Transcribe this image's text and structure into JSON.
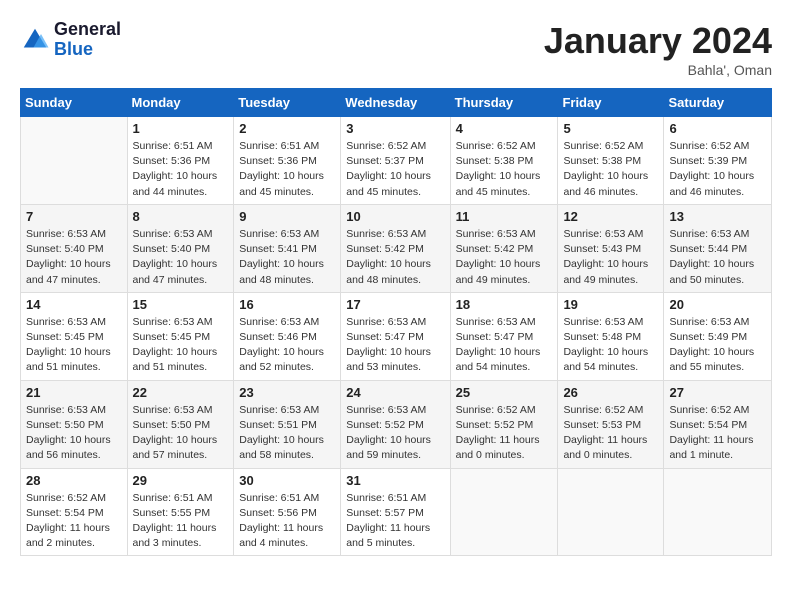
{
  "logo": {
    "line1": "General",
    "line2": "Blue"
  },
  "title": "January 2024",
  "subtitle": "Bahla', Oman",
  "header_days": [
    "Sunday",
    "Monday",
    "Tuesday",
    "Wednesday",
    "Thursday",
    "Friday",
    "Saturday"
  ],
  "weeks": [
    [
      {
        "day": "",
        "info": ""
      },
      {
        "day": "1",
        "info": "Sunrise: 6:51 AM\nSunset: 5:36 PM\nDaylight: 10 hours\nand 44 minutes."
      },
      {
        "day": "2",
        "info": "Sunrise: 6:51 AM\nSunset: 5:36 PM\nDaylight: 10 hours\nand 45 minutes."
      },
      {
        "day": "3",
        "info": "Sunrise: 6:52 AM\nSunset: 5:37 PM\nDaylight: 10 hours\nand 45 minutes."
      },
      {
        "day": "4",
        "info": "Sunrise: 6:52 AM\nSunset: 5:38 PM\nDaylight: 10 hours\nand 45 minutes."
      },
      {
        "day": "5",
        "info": "Sunrise: 6:52 AM\nSunset: 5:38 PM\nDaylight: 10 hours\nand 46 minutes."
      },
      {
        "day": "6",
        "info": "Sunrise: 6:52 AM\nSunset: 5:39 PM\nDaylight: 10 hours\nand 46 minutes."
      }
    ],
    [
      {
        "day": "7",
        "info": "Sunrise: 6:53 AM\nSunset: 5:40 PM\nDaylight: 10 hours\nand 47 minutes."
      },
      {
        "day": "8",
        "info": "Sunrise: 6:53 AM\nSunset: 5:40 PM\nDaylight: 10 hours\nand 47 minutes."
      },
      {
        "day": "9",
        "info": "Sunrise: 6:53 AM\nSunset: 5:41 PM\nDaylight: 10 hours\nand 48 minutes."
      },
      {
        "day": "10",
        "info": "Sunrise: 6:53 AM\nSunset: 5:42 PM\nDaylight: 10 hours\nand 48 minutes."
      },
      {
        "day": "11",
        "info": "Sunrise: 6:53 AM\nSunset: 5:42 PM\nDaylight: 10 hours\nand 49 minutes."
      },
      {
        "day": "12",
        "info": "Sunrise: 6:53 AM\nSunset: 5:43 PM\nDaylight: 10 hours\nand 49 minutes."
      },
      {
        "day": "13",
        "info": "Sunrise: 6:53 AM\nSunset: 5:44 PM\nDaylight: 10 hours\nand 50 minutes."
      }
    ],
    [
      {
        "day": "14",
        "info": "Sunrise: 6:53 AM\nSunset: 5:45 PM\nDaylight: 10 hours\nand 51 minutes."
      },
      {
        "day": "15",
        "info": "Sunrise: 6:53 AM\nSunset: 5:45 PM\nDaylight: 10 hours\nand 51 minutes."
      },
      {
        "day": "16",
        "info": "Sunrise: 6:53 AM\nSunset: 5:46 PM\nDaylight: 10 hours\nand 52 minutes."
      },
      {
        "day": "17",
        "info": "Sunrise: 6:53 AM\nSunset: 5:47 PM\nDaylight: 10 hours\nand 53 minutes."
      },
      {
        "day": "18",
        "info": "Sunrise: 6:53 AM\nSunset: 5:47 PM\nDaylight: 10 hours\nand 54 minutes."
      },
      {
        "day": "19",
        "info": "Sunrise: 6:53 AM\nSunset: 5:48 PM\nDaylight: 10 hours\nand 54 minutes."
      },
      {
        "day": "20",
        "info": "Sunrise: 6:53 AM\nSunset: 5:49 PM\nDaylight: 10 hours\nand 55 minutes."
      }
    ],
    [
      {
        "day": "21",
        "info": "Sunrise: 6:53 AM\nSunset: 5:50 PM\nDaylight: 10 hours\nand 56 minutes."
      },
      {
        "day": "22",
        "info": "Sunrise: 6:53 AM\nSunset: 5:50 PM\nDaylight: 10 hours\nand 57 minutes."
      },
      {
        "day": "23",
        "info": "Sunrise: 6:53 AM\nSunset: 5:51 PM\nDaylight: 10 hours\nand 58 minutes."
      },
      {
        "day": "24",
        "info": "Sunrise: 6:53 AM\nSunset: 5:52 PM\nDaylight: 10 hours\nand 59 minutes."
      },
      {
        "day": "25",
        "info": "Sunrise: 6:52 AM\nSunset: 5:52 PM\nDaylight: 11 hours\nand 0 minutes."
      },
      {
        "day": "26",
        "info": "Sunrise: 6:52 AM\nSunset: 5:53 PM\nDaylight: 11 hours\nand 0 minutes."
      },
      {
        "day": "27",
        "info": "Sunrise: 6:52 AM\nSunset: 5:54 PM\nDaylight: 11 hours\nand 1 minute."
      }
    ],
    [
      {
        "day": "28",
        "info": "Sunrise: 6:52 AM\nSunset: 5:54 PM\nDaylight: 11 hours\nand 2 minutes."
      },
      {
        "day": "29",
        "info": "Sunrise: 6:51 AM\nSunset: 5:55 PM\nDaylight: 11 hours\nand 3 minutes."
      },
      {
        "day": "30",
        "info": "Sunrise: 6:51 AM\nSunset: 5:56 PM\nDaylight: 11 hours\nand 4 minutes."
      },
      {
        "day": "31",
        "info": "Sunrise: 6:51 AM\nSunset: 5:57 PM\nDaylight: 11 hours\nand 5 minutes."
      },
      {
        "day": "",
        "info": ""
      },
      {
        "day": "",
        "info": ""
      },
      {
        "day": "",
        "info": ""
      }
    ]
  ]
}
